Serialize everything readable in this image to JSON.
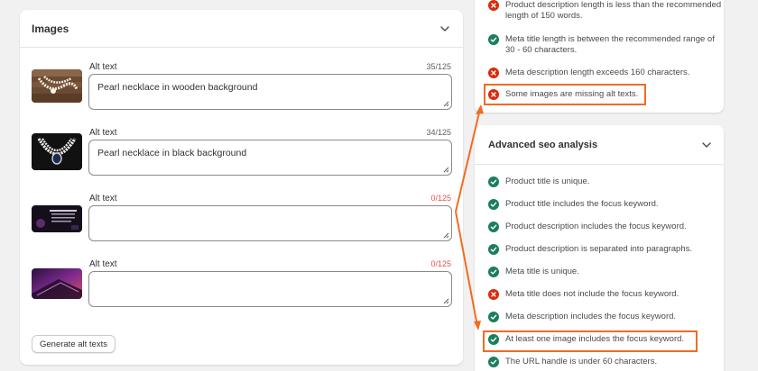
{
  "images_card": {
    "title": "Images",
    "alt_label": "Alt text",
    "rows": [
      {
        "thumb": "pearl-wood",
        "count": "35/125",
        "value": "Pearl necklace in wooden background"
      },
      {
        "thumb": "pearl-black",
        "count": "34/125",
        "value": "Pearl necklace in black background"
      },
      {
        "thumb": "dark-banner",
        "count": "0/125",
        "value": ""
      },
      {
        "thumb": "laptop-purple",
        "count": "0/125",
        "value": ""
      }
    ],
    "generate_label": "Generate alt texts"
  },
  "basic_checks": [
    {
      "status": "error",
      "text": "Product description length is less than the recommended length of 150 words."
    },
    {
      "status": "ok",
      "text": "Meta title length is between the recommended range of 30 - 60 characters."
    },
    {
      "status": "error",
      "text": "Meta description length exceeds 160 characters."
    },
    {
      "status": "error",
      "text": "Some images are missing alt texts."
    }
  ],
  "advanced": {
    "title": "Advanced seo analysis",
    "checks": [
      {
        "status": "ok",
        "text": "Product title is unique."
      },
      {
        "status": "ok",
        "text": "Product title includes the focus keyword."
      },
      {
        "status": "ok",
        "text": "Product description includes the focus keyword."
      },
      {
        "status": "ok",
        "text": "Product description is separated into paragraphs."
      },
      {
        "status": "ok",
        "text": "Meta title is unique."
      },
      {
        "status": "error",
        "text": "Meta title does not include the focus keyword."
      },
      {
        "status": "ok",
        "text": "Meta description includes the focus keyword."
      },
      {
        "status": "ok",
        "text": "At least one image includes the focus keyword."
      },
      {
        "status": "ok",
        "text": "The URL handle is under 60 characters."
      }
    ]
  },
  "colors": {
    "ok": "#1a7f5a",
    "error": "#d72c0d",
    "annotation": "#f26b21",
    "counter_error": "#e5534b"
  },
  "icons": {
    "ok": "check-circle-icon",
    "error": "x-circle-icon",
    "collapse": "chevron-down-icon"
  }
}
